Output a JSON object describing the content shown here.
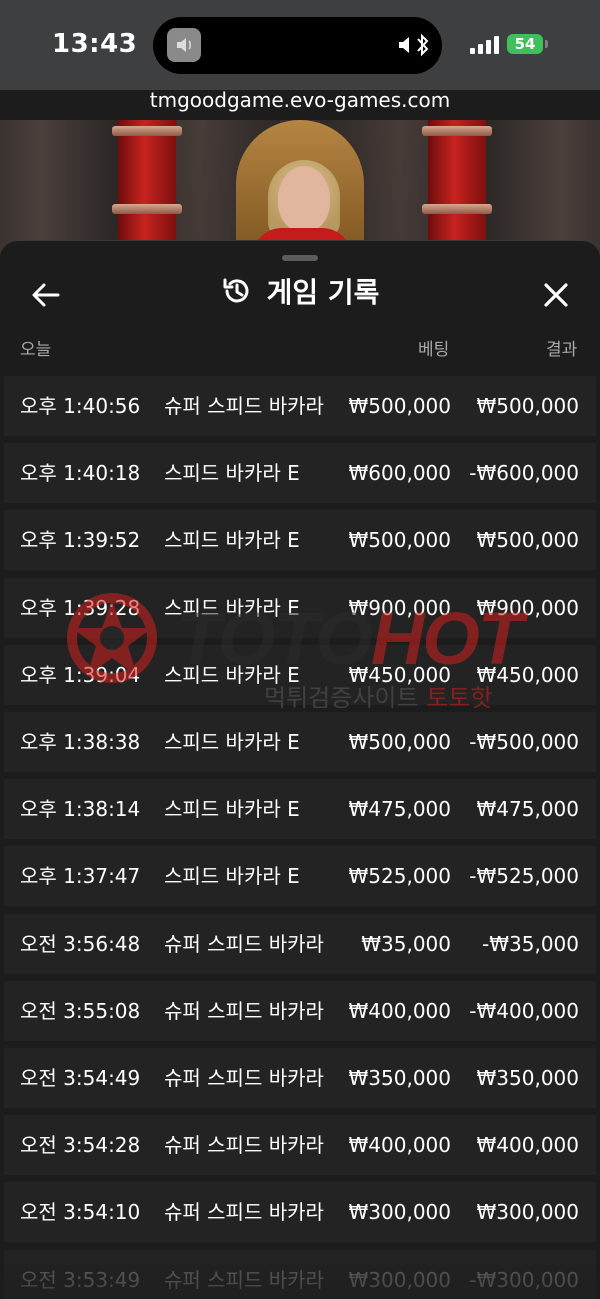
{
  "status_bar": {
    "time": "13:43",
    "battery": "54"
  },
  "browser": {
    "url": "tmgoodgame.evo-games.com"
  },
  "sheet": {
    "title": "게임 기록",
    "headers": {
      "date": "오늘",
      "bet": "베팅",
      "result": "결과"
    }
  },
  "rows": [
    {
      "time": "오후 1:40:56",
      "game": "슈퍼 스피드 바카라",
      "bet": "₩500,000",
      "result": "₩500,000"
    },
    {
      "time": "오후 1:40:18",
      "game": "스피드 바카라 E",
      "bet": "₩600,000",
      "result": "-₩600,000"
    },
    {
      "time": "오후 1:39:52",
      "game": "스피드 바카라 E",
      "bet": "₩500,000",
      "result": "₩500,000"
    },
    {
      "time": "오후 1:39:28",
      "game": "스피드 바카라 E",
      "bet": "₩900,000",
      "result": "₩900,000"
    },
    {
      "time": "오후 1:39:04",
      "game": "스피드 바카라 E",
      "bet": "₩450,000",
      "result": "₩450,000"
    },
    {
      "time": "오후 1:38:38",
      "game": "스피드 바카라 E",
      "bet": "₩500,000",
      "result": "-₩500,000"
    },
    {
      "time": "오후 1:38:14",
      "game": "스피드 바카라 E",
      "bet": "₩475,000",
      "result": "₩475,000"
    },
    {
      "time": "오후 1:37:47",
      "game": "스피드 바카라 E",
      "bet": "₩525,000",
      "result": "-₩525,000"
    },
    {
      "time": "오전 3:56:48",
      "game": "슈퍼 스피드 바카라",
      "bet": "₩35,000",
      "result": "-₩35,000"
    },
    {
      "time": "오전 3:55:08",
      "game": "슈퍼 스피드 바카라",
      "bet": "₩400,000",
      "result": "-₩400,000"
    },
    {
      "time": "오전 3:54:49",
      "game": "슈퍼 스피드 바카라",
      "bet": "₩350,000",
      "result": "₩350,000"
    },
    {
      "time": "오전 3:54:28",
      "game": "슈퍼 스피드 바카라",
      "bet": "₩400,000",
      "result": "₩400,000"
    },
    {
      "time": "오전 3:54:10",
      "game": "슈퍼 스피드 바카라",
      "bet": "₩300,000",
      "result": "₩300,000"
    },
    {
      "time": "오전 3:53:49",
      "game": "슈퍼 스피드 바카라",
      "bet": "₩300,000",
      "result": "-₩300,000"
    }
  ],
  "watermark": {
    "brand_part1": "TOTO",
    "brand_part2": "HOT",
    "tagline": "먹튀검증사이트",
    "tagline_red": "토토핫"
  },
  "icons": {
    "back": "arrow-left-icon",
    "history": "history-icon",
    "close": "close-icon"
  },
  "colors": {
    "sheet_bg": "#1c1c1c",
    "row_bg": "#232323",
    "text": "#ffffff",
    "header_text": "#a9a9a9",
    "battery": "#3ec15a",
    "watermark_red": "#d0201c"
  }
}
